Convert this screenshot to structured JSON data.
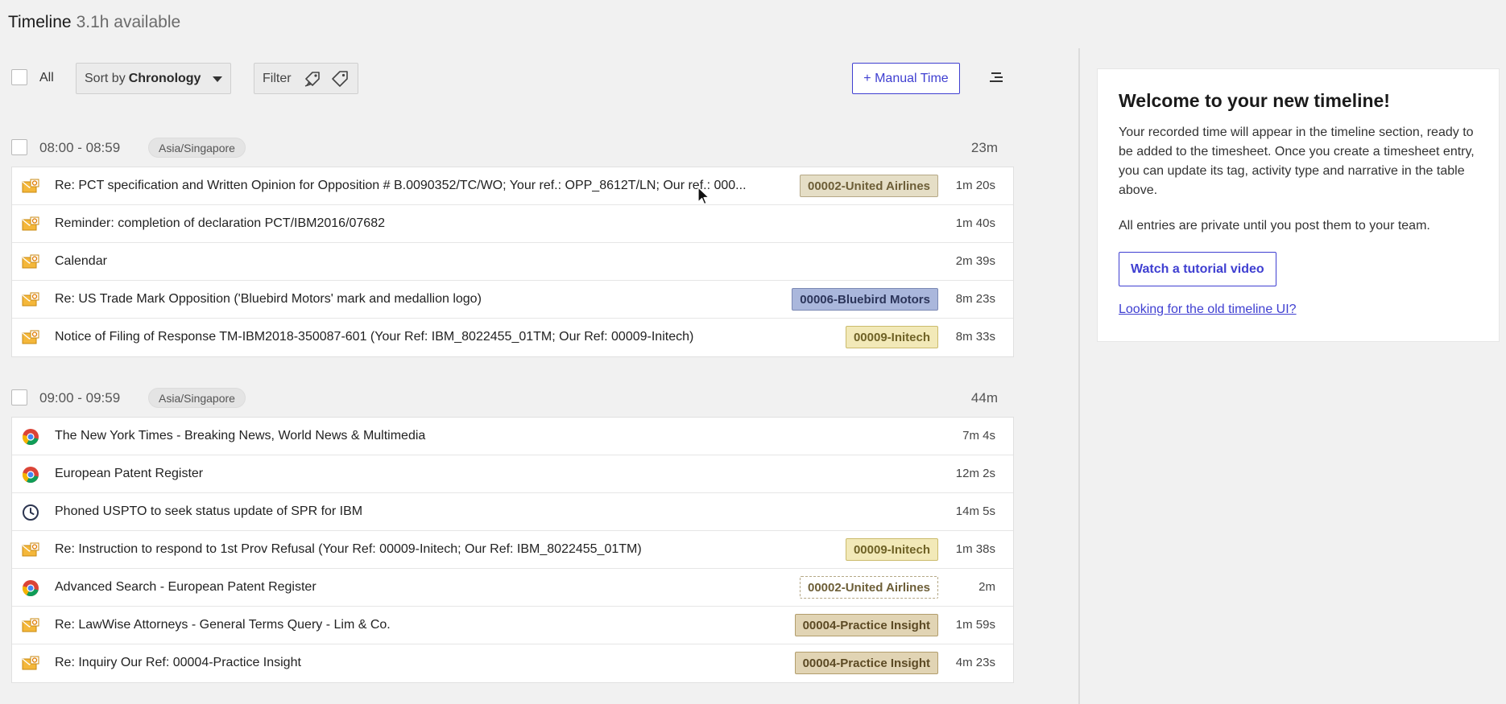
{
  "header": {
    "title": "Timeline",
    "available": "3.1h available"
  },
  "toolbar": {
    "all_label": "All",
    "sort_prefix": "Sort by",
    "sort_value": "Chronology",
    "filter_label": "Filter",
    "manual_time_label": "+ Manual Time"
  },
  "groups": [
    {
      "range": "08:00 - 08:59",
      "timezone": "Asia/Singapore",
      "total": "23m",
      "rows": [
        {
          "icon": "outlook-icon",
          "title": "Re: PCT specification and Written Opinion for Opposition # B.0090352/TC/WO; Your ref.: OPP_8612T/LN; Our ref.: 000...",
          "tag": "00002-United Airlines",
          "tag_style": "ua",
          "duration": "1m 20s"
        },
        {
          "icon": "outlook-icon",
          "title": "Reminder: completion of declaration PCT/IBM2016/07682",
          "tag": "",
          "tag_style": "",
          "duration": "1m 40s"
        },
        {
          "icon": "outlook-icon",
          "title": "Calendar",
          "tag": "",
          "tag_style": "",
          "duration": "2m 39s"
        },
        {
          "icon": "outlook-icon",
          "title": "Re: US Trade Mark Opposition ('Bluebird Motors' mark and medallion logo)",
          "tag": "00006-Bluebird Motors",
          "tag_style": "bb",
          "duration": "8m 23s"
        },
        {
          "icon": "outlook-icon",
          "title": "Notice of Filing of Response TM-IBM2018-350087-601 (Your Ref: IBM_8022455_01TM; Our Ref: 00009-Initech)",
          "tag": "00009-Initech",
          "tag_style": "in",
          "duration": "8m 33s"
        }
      ]
    },
    {
      "range": "09:00 - 09:59",
      "timezone": "Asia/Singapore",
      "total": "44m",
      "rows": [
        {
          "icon": "chrome-icon",
          "title": "The New York Times - Breaking News, World News & Multimedia",
          "tag": "",
          "tag_style": "",
          "duration": "7m 4s"
        },
        {
          "icon": "chrome-icon",
          "title": "European Patent Register",
          "tag": "",
          "tag_style": "",
          "duration": "12m 2s"
        },
        {
          "icon": "clock-icon",
          "title": "Phoned USPTO to seek status update of SPR for IBM",
          "tag": "",
          "tag_style": "",
          "duration": "14m 5s"
        },
        {
          "icon": "outlook-icon",
          "title": "Re: Instruction to respond to 1st Prov Refusal (Your Ref: 00009-Initech; Our Ref: IBM_8022455_01TM)",
          "tag": "00009-Initech",
          "tag_style": "in",
          "duration": "1m 38s"
        },
        {
          "icon": "chrome-icon",
          "title": "Advanced Search - European Patent Register",
          "tag": "00002-United Airlines",
          "tag_style": "ua-dashed",
          "duration": "2m"
        },
        {
          "icon": "outlook-icon",
          "title": "Re: LawWise Attorneys - General Terms Query - Lim & Co.",
          "tag": "00004-Practice Insight",
          "tag_style": "pi",
          "duration": "1m 59s"
        },
        {
          "icon": "outlook-icon",
          "title": "Re: Inquiry Our Ref: 00004-Practice Insight",
          "tag": "00004-Practice Insight",
          "tag_style": "pi",
          "duration": "4m 23s"
        }
      ]
    }
  ],
  "welcome": {
    "heading": "Welcome to your new timeline!",
    "body1": "Your recorded time will appear in the timeline section, ready to be added to the timesheet. Once you create a timesheet entry, you can update its tag, activity type and narrative in the table above.",
    "body2": "All entries are private until you post them to your team.",
    "tutorial_label": "Watch a tutorial video",
    "old_ui_link": "Looking for the old timeline UI?"
  },
  "colors": {
    "accent": "#3f3fd1",
    "tag_united_airlines": "#e5dec6",
    "tag_bluebird": "#aab7dc",
    "tag_initech": "#f2e9b8",
    "tag_practice_insight": "#e1d4b4"
  }
}
